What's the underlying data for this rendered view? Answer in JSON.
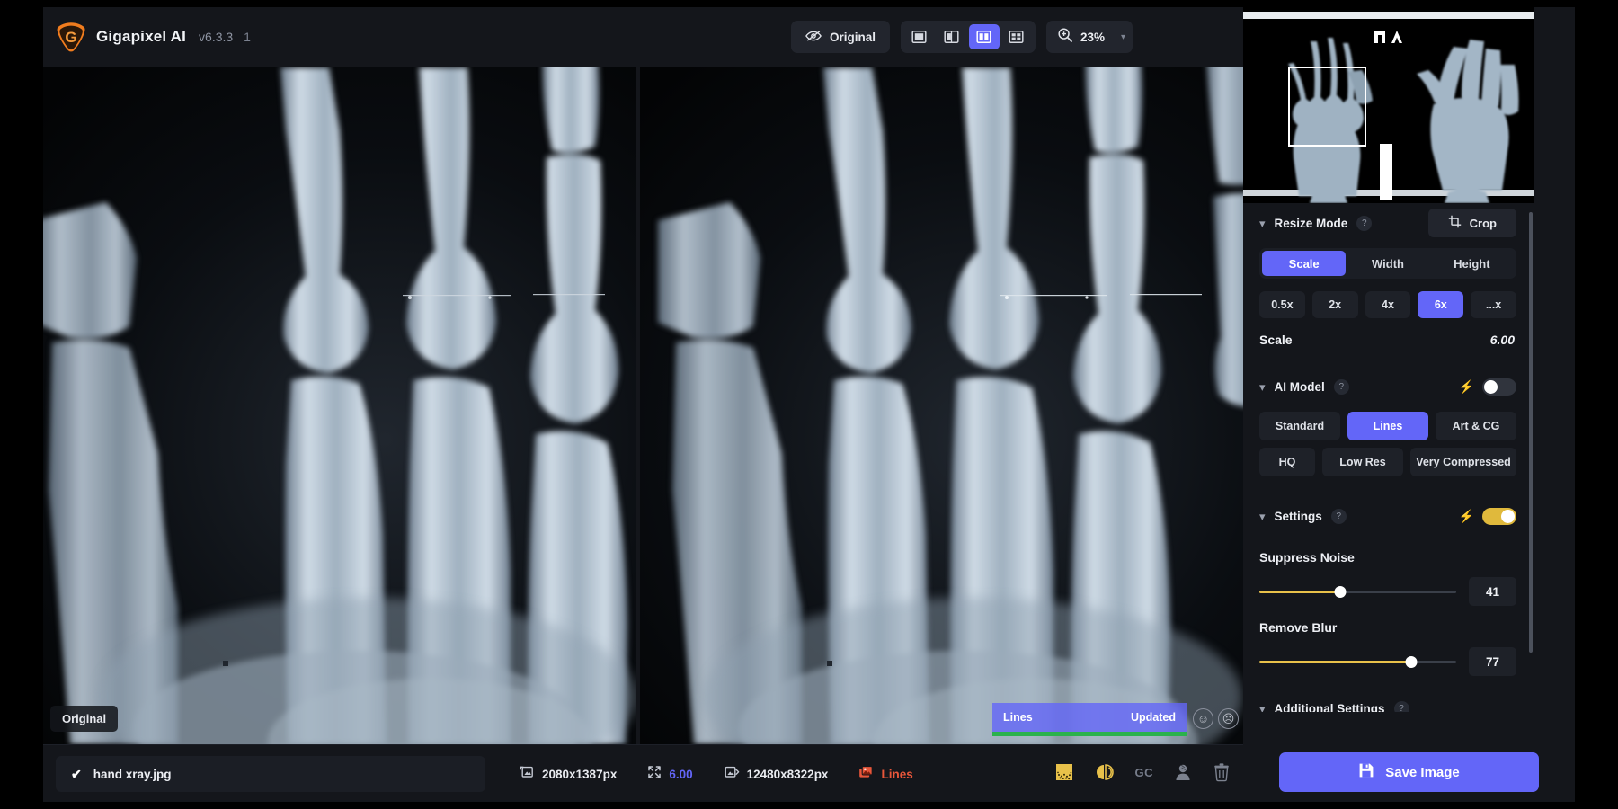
{
  "app": {
    "brand_name": "Gigapixel AI",
    "version": "v6.3.3",
    "build_suffix": "1"
  },
  "toolbar": {
    "original_label": "Original",
    "original_icon": "eye-slash-icon",
    "view_modes": [
      {
        "name": "single-view",
        "icon": "single-pane-icon",
        "active": false
      },
      {
        "name": "split-view",
        "icon": "split-pane-icon",
        "active": false
      },
      {
        "name": "side-by-side-view",
        "icon": "two-pane-icon",
        "active": true
      },
      {
        "name": "grid-view",
        "icon": "grid-pane-icon",
        "active": false
      }
    ],
    "zoom_icon": "magnifier-plus-icon",
    "zoom_level": "23%",
    "zoom_caret": "chevron-down-icon"
  },
  "viewer": {
    "left_tag": "Original",
    "processed_badge": {
      "model": "Lines",
      "status": "Updated",
      "progress_color": "#2bb24c"
    },
    "rate_good_icon": "smiley-happy-icon",
    "rate_bad_icon": "smiley-neutral-icon"
  },
  "statusbar": {
    "file_checked_icon": "check-icon",
    "filename": "hand xray.jpg",
    "input_size_icon": "image-in-icon",
    "input_size": "2080x1387px",
    "scale_icon": "resize-arrows-icon",
    "scale_value": "6.00",
    "output_size_icon": "image-out-icon",
    "output_size": "12480x8322px",
    "model_icon": "model-swatch-icon",
    "model_name": "Lines",
    "icons": [
      {
        "name": "grain-preview-icon",
        "label": ""
      },
      {
        "name": "compare-contrast-icon",
        "label": ""
      },
      {
        "name": "gc-label",
        "label": "GC"
      },
      {
        "name": "face-recovery-icon",
        "label": ""
      },
      {
        "name": "trash-icon",
        "label": ""
      }
    ]
  },
  "panel": {
    "navigator": {
      "name": "navigator-preview"
    },
    "resize": {
      "title": "Resize Mode",
      "help": "?",
      "crop_label": "Crop",
      "crop_icon": "crop-icon",
      "modes": [
        {
          "label": "Scale",
          "active": true
        },
        {
          "label": "Width",
          "active": false
        },
        {
          "label": "Height",
          "active": false
        }
      ],
      "presets": [
        {
          "label": "0.5x",
          "active": false
        },
        {
          "label": "2x",
          "active": false
        },
        {
          "label": "4x",
          "active": false
        },
        {
          "label": "6x",
          "active": true
        },
        {
          "label": "...x",
          "active": false
        }
      ],
      "scale_key": "Scale",
      "scale_value": "6.00"
    },
    "ai_model": {
      "title": "AI Model",
      "help": "?",
      "auto_enabled": false,
      "bolt_icon": "bolt-icon",
      "models_row1": [
        {
          "label": "Standard",
          "active": false
        },
        {
          "label": "Lines",
          "active": true
        },
        {
          "label": "Art & CG",
          "active": false
        }
      ],
      "models_row2": [
        {
          "label": "HQ",
          "active": false
        },
        {
          "label": "Low Res",
          "active": false
        },
        {
          "label": "Very Compressed",
          "active": false
        }
      ]
    },
    "settings": {
      "title": "Settings",
      "help": "?",
      "auto_enabled": true,
      "bolt_icon": "bolt-icon",
      "sliders": [
        {
          "label": "Suppress Noise",
          "value": "41",
          "percent": 41
        },
        {
          "label": "Remove Blur",
          "value": "77",
          "percent": 77
        }
      ]
    },
    "additional": {
      "title": "Additional Settings",
      "help": "?"
    },
    "save_label": "Save Image",
    "save_icon": "floppy-disk-icon"
  },
  "colors": {
    "accent": "#6366f8",
    "gold": "#e8c14a",
    "green": "#2bb24c",
    "warn": "#e8563a",
    "panel_bg": "#14161b"
  }
}
